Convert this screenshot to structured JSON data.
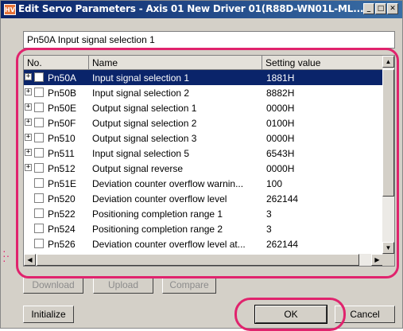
{
  "window": {
    "title": "Edit Servo Parameters - Axis 01 New Driver 01(R88D-WN01L-ML...",
    "icon_label": "HV",
    "controls": [
      "minimize-icon",
      "maximize-icon",
      "close-icon"
    ]
  },
  "description": "Pn50A Input signal selection 1",
  "table": {
    "columns": [
      "No.",
      "Name",
      "Setting value"
    ],
    "rows": [
      {
        "no": "Pn50A",
        "name": "Input signal selection 1",
        "value": "1881H",
        "expandable": true,
        "selected": true
      },
      {
        "no": "Pn50B",
        "name": "Input signal selection 2",
        "value": "8882H",
        "expandable": true
      },
      {
        "no": "Pn50E",
        "name": "Output signal selection 1",
        "value": "0000H",
        "expandable": true
      },
      {
        "no": "Pn50F",
        "name": "Output signal selection 2",
        "value": "0100H",
        "expandable": true
      },
      {
        "no": "Pn510",
        "name": "Output signal selection 3",
        "value": "0000H",
        "expandable": true
      },
      {
        "no": "Pn511",
        "name": "Input signal selection 5",
        "value": "6543H",
        "expandable": true
      },
      {
        "no": "Pn512",
        "name": "Output signal reverse",
        "value": "0000H",
        "expandable": true
      },
      {
        "no": "Pn51E",
        "name": "Deviation counter overflow warnin...",
        "value": "100",
        "expandable": false
      },
      {
        "no": "Pn520",
        "name": "Deviation counter overflow level",
        "value": "262144",
        "expandable": false
      },
      {
        "no": "Pn522",
        "name": "Positioning completion range 1",
        "value": "3",
        "expandable": false
      },
      {
        "no": "Pn524",
        "name": "Positioning completion range 2",
        "value": "3",
        "expandable": false
      },
      {
        "no": "Pn526",
        "name": "Deviation counter overflow level at...",
        "value": "262144",
        "expandable": false
      }
    ]
  },
  "buttons": {
    "download": "Download",
    "upload": "Upload",
    "compare": "Compare",
    "initialize": "Initialize",
    "ok": "OK",
    "cancel": "Cancel"
  },
  "colors": {
    "highlight": "#e0236d",
    "selection": "#0a246a"
  }
}
